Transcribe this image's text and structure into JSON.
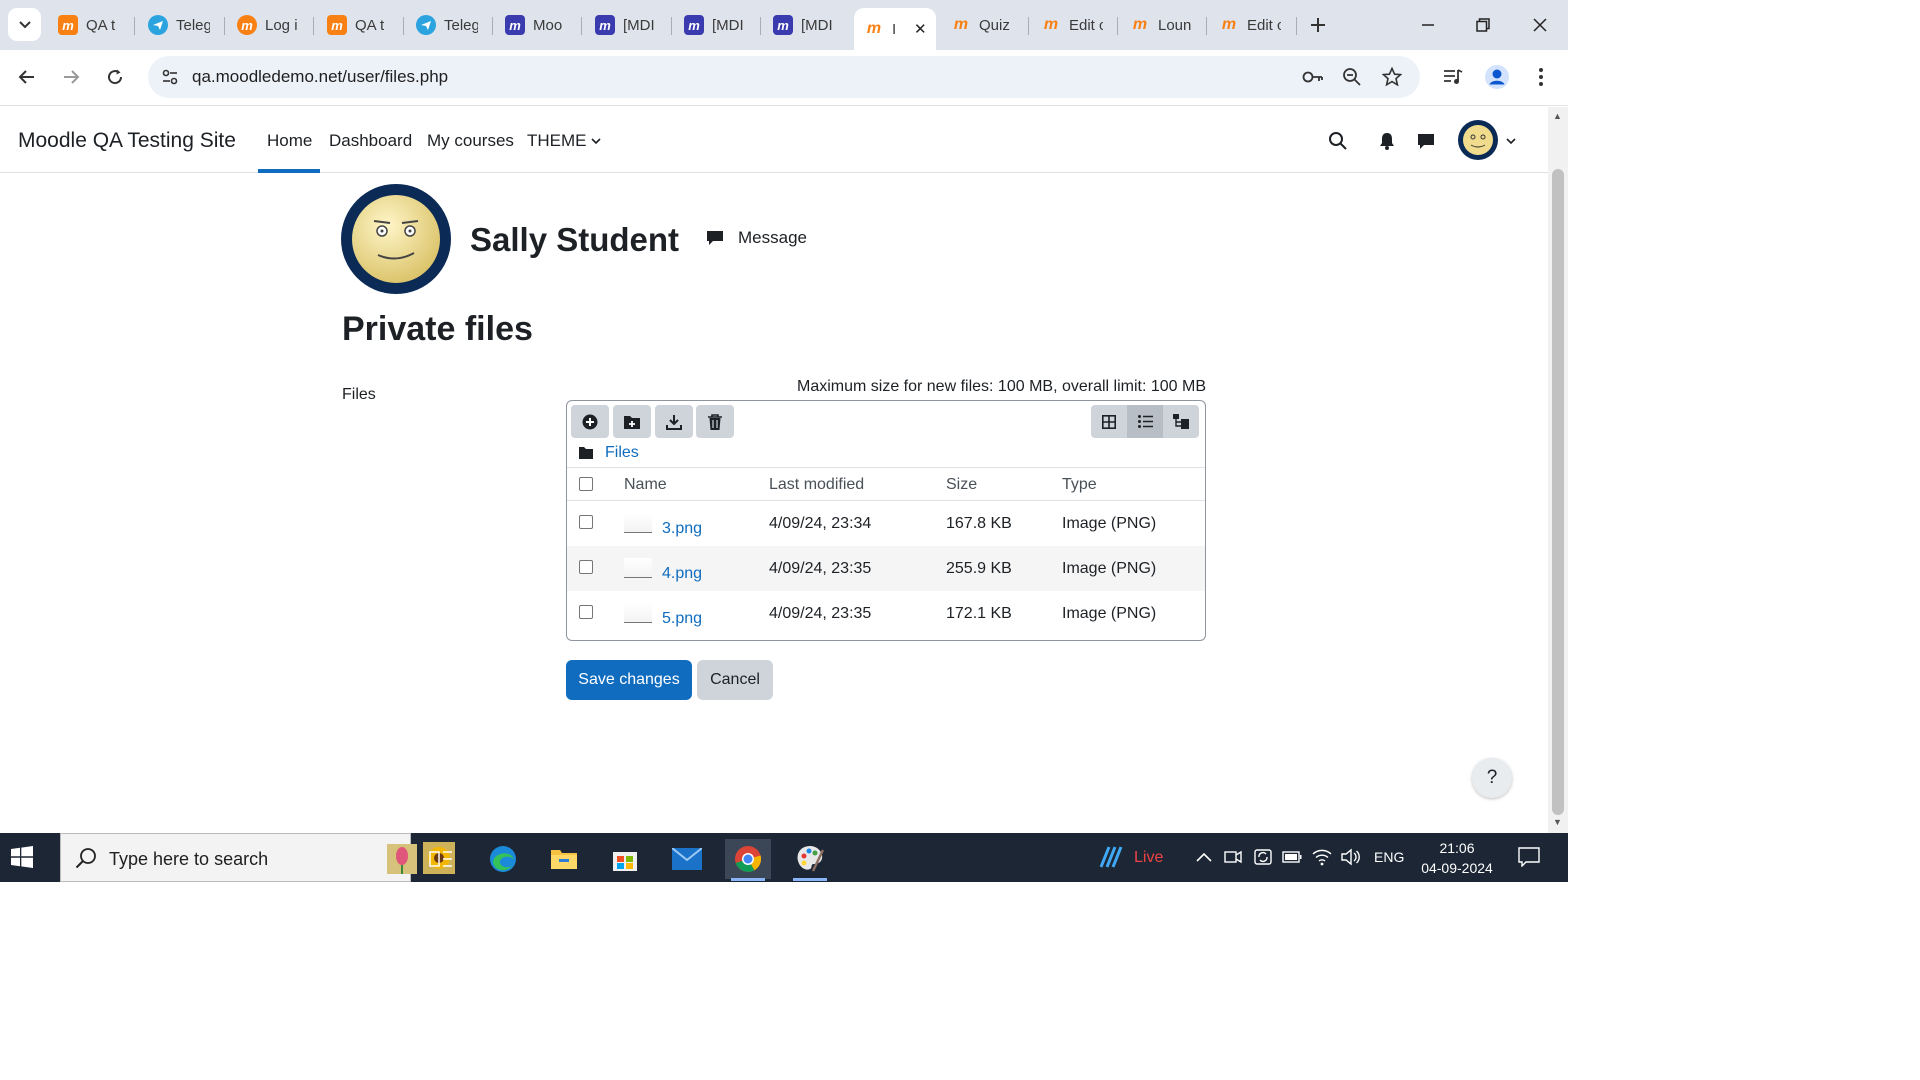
{
  "browser": {
    "tabs": [
      {
        "title": "QA t",
        "icon": "moodle-favicon"
      },
      {
        "title": "Teleg",
        "icon": "telegram-favicon"
      },
      {
        "title": "Log i",
        "icon": "moodle-favicon"
      },
      {
        "title": "QA t",
        "icon": "moodle-favicon"
      },
      {
        "title": "Teleg",
        "icon": "telegram-favicon"
      },
      {
        "title": "Moo",
        "icon": "mdl-favicon"
      },
      {
        "title": "[MDI",
        "icon": "mdl-favicon"
      },
      {
        "title": "[MDI",
        "icon": "mdl-favicon"
      },
      {
        "title": "[MDI",
        "icon": "mdl-favicon"
      },
      {
        "title": "I",
        "icon": "moodle-favicon",
        "active": true
      },
      {
        "title": "Quiz",
        "icon": "moodle-favicon"
      },
      {
        "title": "Edit c",
        "icon": "moodle-favicon"
      },
      {
        "title": "Loun",
        "icon": "moodle-favicon"
      },
      {
        "title": "Edit c",
        "icon": "moodle-favicon"
      }
    ],
    "url": "qa.moodledemo.net/user/files.php"
  },
  "navbar": {
    "brand": "Moodle QA Testing Site",
    "items": [
      "Home",
      "Dashboard",
      "My courses",
      "THEME"
    ],
    "active": "Home"
  },
  "profile": {
    "name": "Sally Student",
    "message_label": "Message"
  },
  "page": {
    "title": "Private files",
    "files_label": "Files",
    "max_size_text": "Maximum size for new files: 100 MB, overall limit: 100 MB",
    "breadcrumb": "Files",
    "columns": [
      "Name",
      "Last modified",
      "Size",
      "Type"
    ],
    "files": [
      {
        "name": "3.png",
        "modified": "4/09/24, 23:34",
        "size": "167.8 KB",
        "type": "Image (PNG)"
      },
      {
        "name": "4.png",
        "modified": "4/09/24, 23:35",
        "size": "255.9 KB",
        "type": "Image (PNG)"
      },
      {
        "name": "5.png",
        "modified": "4/09/24, 23:35",
        "size": "172.1 KB",
        "type": "Image (PNG)"
      }
    ],
    "save_label": "Save changes",
    "cancel_label": "Cancel",
    "help_label": "?"
  },
  "taskbar": {
    "search_placeholder": "Type here to search",
    "live_label": "Live",
    "lang": "ENG",
    "time": "21:06",
    "date": "04-09-2024"
  },
  "colors": {
    "accent": "#0f6cbf",
    "taskbar": "#1c2634",
    "tabstrip": "#dfe3eb"
  }
}
